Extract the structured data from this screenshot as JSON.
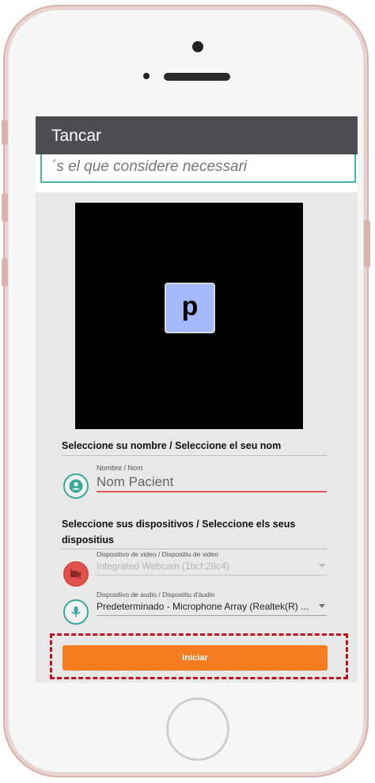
{
  "topbar": {
    "title": "Tancar"
  },
  "hint": {
    "text": "´s el que considere necessari"
  },
  "video": {
    "avatar_letter": "p",
    "avatar_color": "#a4b9fb"
  },
  "name_section": {
    "title": "Seleccione su nombre / Seleccione el seu nom",
    "field_label": "Nombre / Nom",
    "field_value": "Nom Pacient",
    "icon": "person-icon"
  },
  "devices_section": {
    "title": "Seleccione sus dispositivos / Seleccione els seus dispositius",
    "video": {
      "label": "Dispositivo de video / Dispositiu de video",
      "value": "Integrated Webcam (1bcf:28c4)",
      "icon": "video-off-icon",
      "disabled": true
    },
    "audio": {
      "label": "Dispositivo de audio / Dispositiu d'àudio",
      "value": "Predeterminado - Microphone Array (Realtek(R) ...",
      "icon": "microphone-icon"
    }
  },
  "start_button": {
    "label": "Iniciar",
    "color": "#f57c1f"
  },
  "colors": {
    "accent": "#3aa89a",
    "highlight": "#c1121f",
    "topbar": "#4a4d51"
  }
}
